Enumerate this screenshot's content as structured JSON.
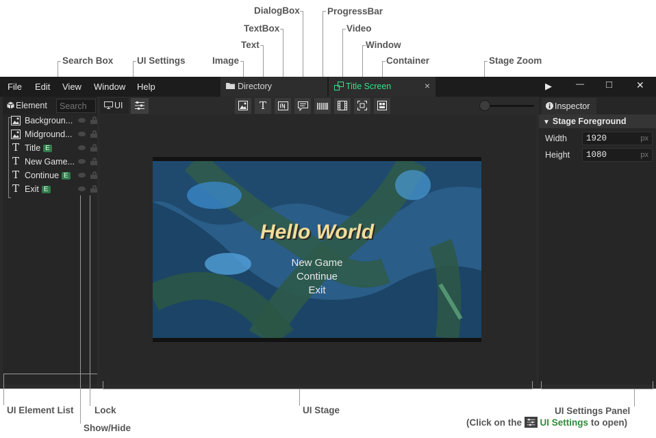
{
  "annotations": {
    "search_box": "Search Box",
    "ui_settings": "UI Settings",
    "image": "Image",
    "text": "Text",
    "textbox": "TextBox",
    "dialogbox": "DialogBox",
    "progressbar": "ProgressBar",
    "video": "Video",
    "window": "Window",
    "container": "Container",
    "stage_zoom": "Stage Zoom",
    "ui_element_list": "UI Element List",
    "lock": "Lock",
    "show_hide": "Show/Hide",
    "ui_stage": "UI Stage",
    "ui_settings_panel": "UI Settings Panel",
    "click_prefix": "(Click on the",
    "click_link": "UI Settings",
    "click_suffix": "to open)"
  },
  "menu": [
    "File",
    "Edit",
    "View",
    "Window",
    "Help"
  ],
  "tabs": {
    "directory": "Directory",
    "title_screen": "Title Screen",
    "close": "×"
  },
  "window_controls": {
    "play": "▶",
    "minimize": "—",
    "maximize": "□",
    "close": "✕"
  },
  "left_panel": {
    "title": "Element",
    "search_placeholder": "Search",
    "elements": [
      {
        "label": "Backgroun...",
        "kind": "image",
        "badge": ""
      },
      {
        "label": "Midground...",
        "kind": "image",
        "badge": ""
      },
      {
        "label": "Title",
        "kind": "text",
        "badge": "E"
      },
      {
        "label": "New Game...",
        "kind": "text",
        "badge": ""
      },
      {
        "label": "Continue",
        "kind": "text",
        "badge": "E"
      },
      {
        "label": "Exit",
        "kind": "text",
        "badge": "E"
      }
    ]
  },
  "toolbar": {
    "ui_tab": "UI",
    "text_tool": "T"
  },
  "stage": {
    "title": "Hello World",
    "menu": [
      "New Game",
      "Continue",
      "Exit"
    ],
    "zoom_level": 0
  },
  "inspector": {
    "tab": "Inspector",
    "section": "Stage Foreground",
    "width_label": "Width",
    "width_value": "1920",
    "height_label": "Height",
    "height_value": "1080",
    "unit": "px"
  },
  "colors": {
    "accent_green": "#38e08a",
    "badge_green": "#2f7a4a",
    "menubar": "#1c1c1c",
    "panel": "#262626",
    "annotation_text": "#555555",
    "settings_link": "#2e8b3a"
  }
}
